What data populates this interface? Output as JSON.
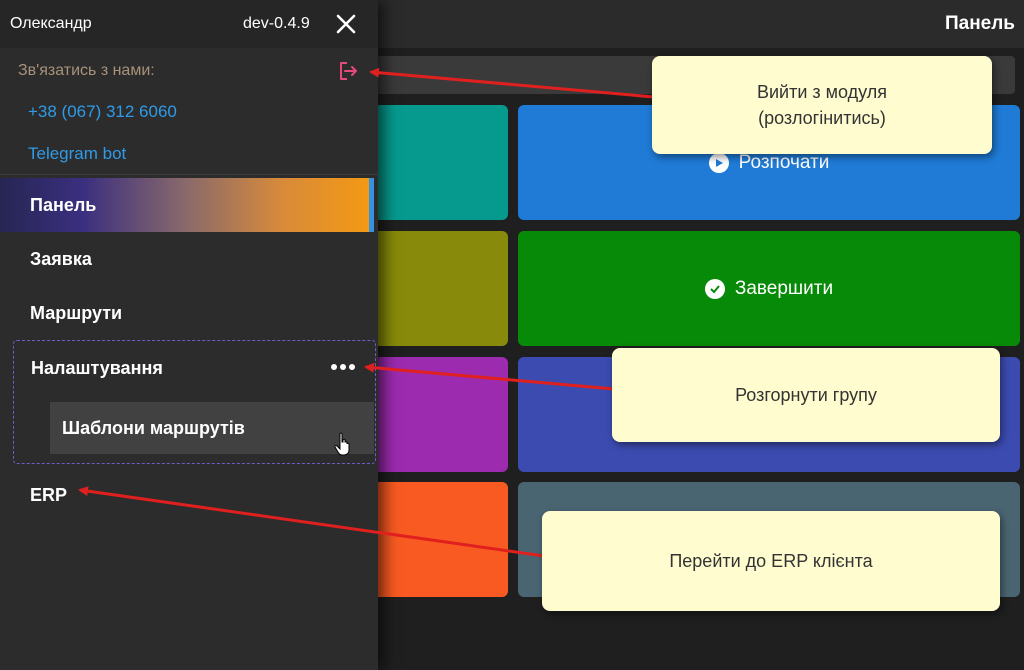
{
  "header": {
    "title": "Панель"
  },
  "tiles": [
    {
      "label": "",
      "color": "#069a8e"
    },
    {
      "label": "Розпочати",
      "icon": "play-circle-icon",
      "color": "#1f7bd6"
    },
    {
      "label": "",
      "color": "#878a0a"
    },
    {
      "label": "Завершити",
      "icon": "check-circle-icon",
      "color": "#078a07"
    },
    {
      "label": "",
      "color": "#9c2bb0"
    },
    {
      "label": "",
      "color": "#3c4bb0"
    },
    {
      "label": "",
      "color": "#f95a22"
    },
    {
      "label": "",
      "color": "#4a6572"
    }
  ],
  "drawer": {
    "user_name": "Олександр",
    "version": "dev-0.4.9",
    "contact_label": "Зв'язатись з нами:",
    "phone": "+38 (067) 312 6060",
    "telegram": "Telegram bot",
    "nav": {
      "panel": "Панель",
      "request": "Заявка",
      "routes": "Маршрути",
      "settings": "Налаштування",
      "route_templates": "Шаблони маршрутів",
      "erp": "ERP"
    }
  },
  "callouts": {
    "logout": "Вийти з модуля\n(розлогінитись)",
    "expand_group": "Розгорнути групу",
    "erp": "Перейти до ERP клієнта"
  },
  "colors": {
    "accent_link": "#2f9be8",
    "callout_bg": "#fffccf",
    "arrow": "#e0201e",
    "logout_icon": "#e8487a"
  }
}
